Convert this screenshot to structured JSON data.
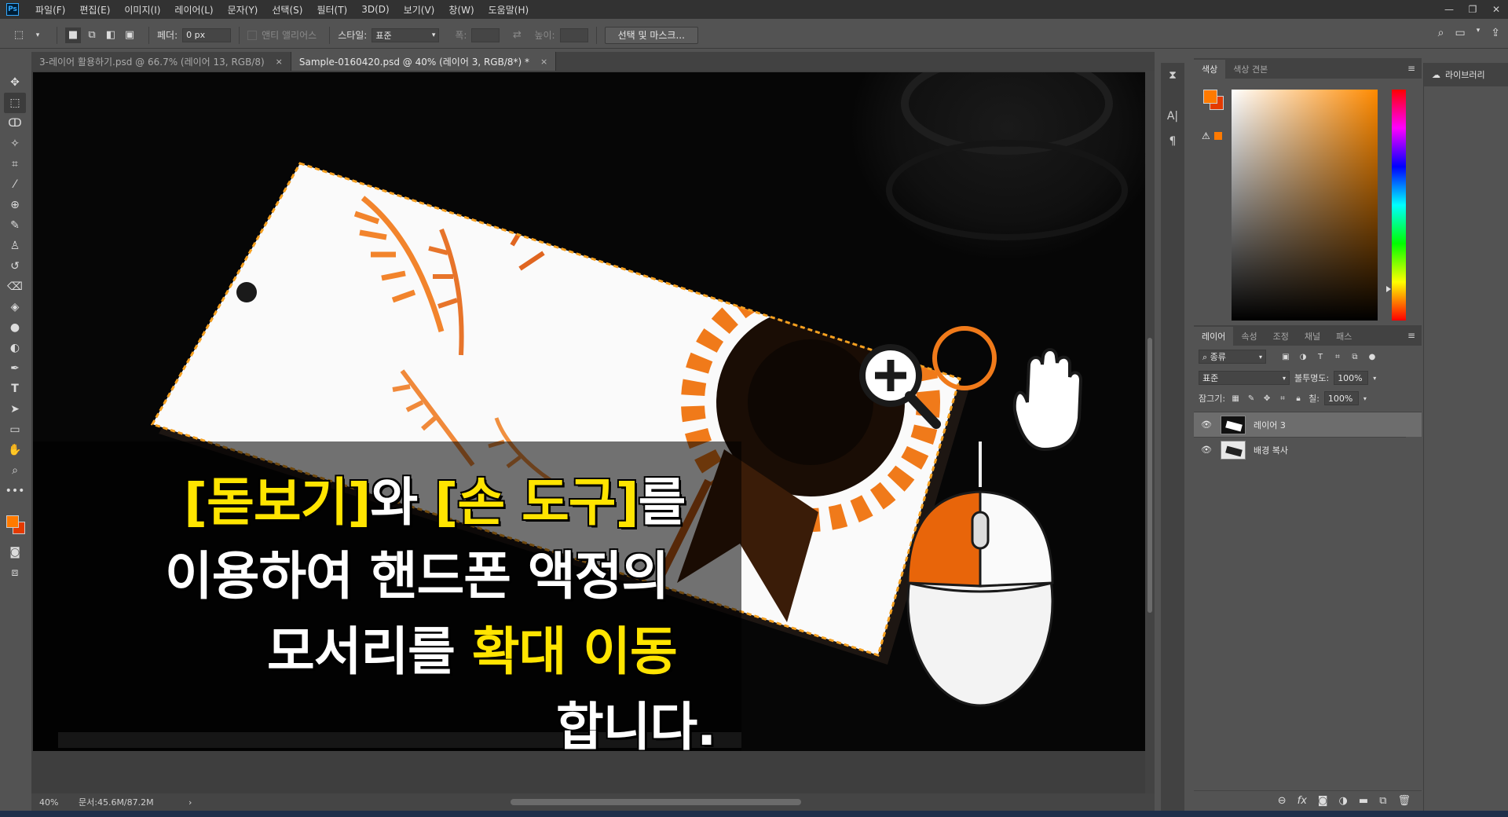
{
  "app": {
    "logo": "Ps",
    "menu": [
      "파일(F)",
      "편집(E)",
      "이미지(I)",
      "레이어(L)",
      "문자(Y)",
      "선택(S)",
      "필터(T)",
      "3D(D)",
      "보기(V)",
      "창(W)",
      "도움말(H)"
    ]
  },
  "options": {
    "feather_label": "페더:",
    "feather_value": "0 px",
    "antialias_label": "앤티 앨리어스",
    "style_label": "스타일:",
    "style_value": "표준",
    "width_label": "폭:",
    "height_label": "높이:",
    "select_mask_button": "선택 및 마스크..."
  },
  "tabs": [
    {
      "label": "3-레이어 활용하기.psd @ 66.7% (레이어 13, RGB/8)",
      "close": "×"
    },
    {
      "label": "Sample-0160420.psd @ 40% (레이어 3, RGB/8*) *",
      "close": "×"
    }
  ],
  "status": {
    "zoom": "40%",
    "doc": "문서:45.6M/87.2M",
    "arrow": "›"
  },
  "color_panel": {
    "tabs": [
      "색상",
      "색상 견본"
    ],
    "foreground": "#ff7a00",
    "background": "#e43a00"
  },
  "layers_panel": {
    "tabs": [
      "레이어",
      "속성",
      "조정",
      "채널",
      "패스"
    ],
    "filter_label": "종류",
    "blend_mode": "표준",
    "opacity_label": "불투명도:",
    "opacity_value": "100%",
    "lock_label": "잠그기:",
    "fill_label": "칠:",
    "fill_value": "100%",
    "layers": [
      {
        "name": "레이어 3",
        "selected": true
      },
      {
        "name": "배경 복사",
        "selected": false
      }
    ]
  },
  "library": {
    "label": "라이브러리"
  },
  "caption": {
    "line1_a": "[돋보기]",
    "line1_b": "와 ",
    "line1_c": "[손 도구]",
    "line1_d": "를",
    "line2": "이용하여 핸드폰 액정의",
    "line3_a": "모서리를 ",
    "line3_b": "확대 이동",
    "line4": "합니다."
  },
  "colors": {
    "accent_orange": "#f07a1a",
    "caption_yellow": "#ffe400"
  }
}
